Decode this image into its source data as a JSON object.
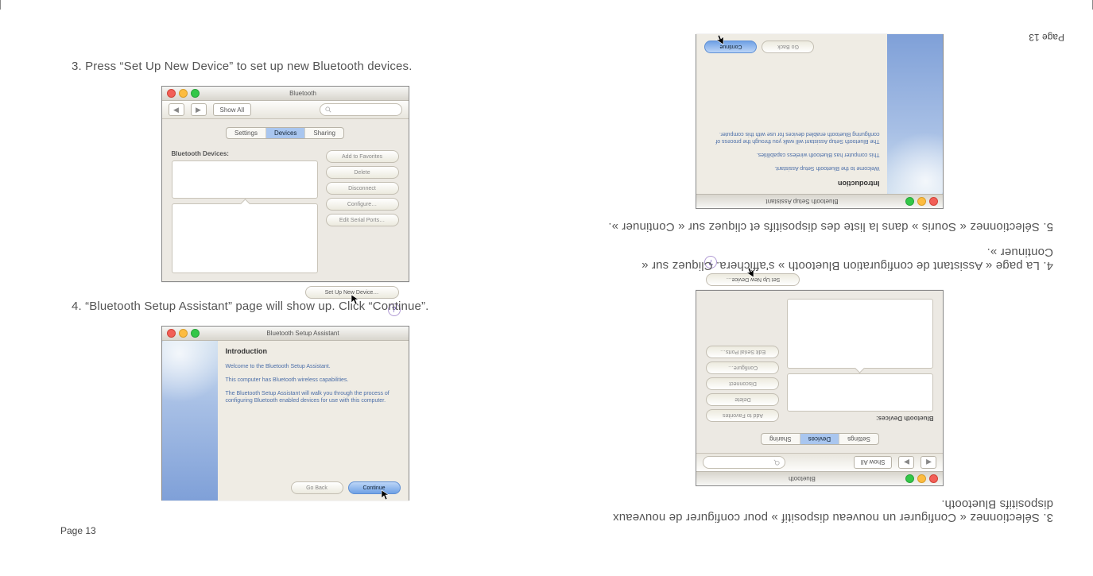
{
  "page_label": "Page 13",
  "left": {
    "step3": "3. Press “Set Up New Device” to set up new Bluetooth devices.",
    "step4": "4. “Bluetooth Setup Assistant” page will show up. Click “Continue”."
  },
  "right": {
    "step3": "3. Sélectionnez « Configurer un nouveau dispositif » pour configurer de nouveaux dispositifs Bluetooth.",
    "step4": "4. La page « Assistant de configuration Bluetooth » s'affichera. Cliquez sur « Continuer ».",
    "step5": "5. Sélectionnez « Souris » dans la liste des dispositifs et cliquez sur « Continuer »."
  },
  "bt_prefs": {
    "window_title": "Bluetooth",
    "show_all": "Show All",
    "tabs": {
      "settings": "Settings",
      "devices": "Devices",
      "sharing": "Sharing"
    },
    "devices_label": "Bluetooth Devices:",
    "buttons": {
      "fav": "Add to Favorites",
      "del": "Delete",
      "disc": "Disconnect",
      "conf": "Configure…",
      "ports": "Edit Serial Ports…",
      "setup": "Set Up New Device…"
    }
  },
  "bsa": {
    "window_title": "Bluetooth Setup Assistant",
    "heading": "Introduction",
    "p1": "Welcome to the Bluetooth Setup Assistant.",
    "p2": "This computer has Bluetooth wireless capabilities.",
    "p3": "The Bluetooth Setup Assistant will walk you through the process of configuring Bluetooth enabled devices for use with this computer.",
    "go_back": "Go Back",
    "continue": "Continue"
  }
}
